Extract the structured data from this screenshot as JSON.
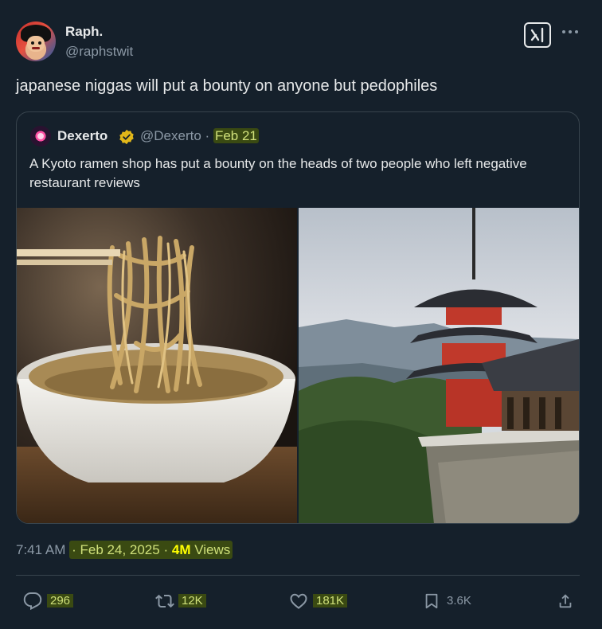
{
  "author": {
    "display_name": "Raph.",
    "handle": "@raphstwit"
  },
  "tweet_text": "japanese niggas will put a bounty on anyone but pedophiles",
  "quoted": {
    "display_name": "Dexerto",
    "handle": "@Dexerto",
    "separator": "·",
    "date": "Feb 21",
    "text": "A Kyoto ramen shop has put a bounty on the heads of two people who left negative restaurant reviews",
    "images": [
      "ramen-noodles-photo",
      "kyoto-pagoda-photo"
    ]
  },
  "meta": {
    "time": "7:41 AM",
    "sep1": "·",
    "date": "Feb 24, 2025",
    "sep2": "·",
    "views_count": "4M",
    "views_label": "Views"
  },
  "actions": {
    "replies": "296",
    "reposts": "12K",
    "likes": "181K",
    "bookmarks": "3.6K"
  },
  "icons": {
    "grok": "grok-icon",
    "more": "more-icon",
    "verified": "verified-badge-icon",
    "reply": "reply-icon",
    "repost": "repost-icon",
    "like": "heart-icon",
    "bookmark": "bookmark-icon",
    "share": "share-icon"
  },
  "colors": {
    "background": "#15202b",
    "text": "#e7e9ea",
    "muted": "#8b98a5",
    "border": "#38444d",
    "verified_gold": "#e2b719"
  }
}
